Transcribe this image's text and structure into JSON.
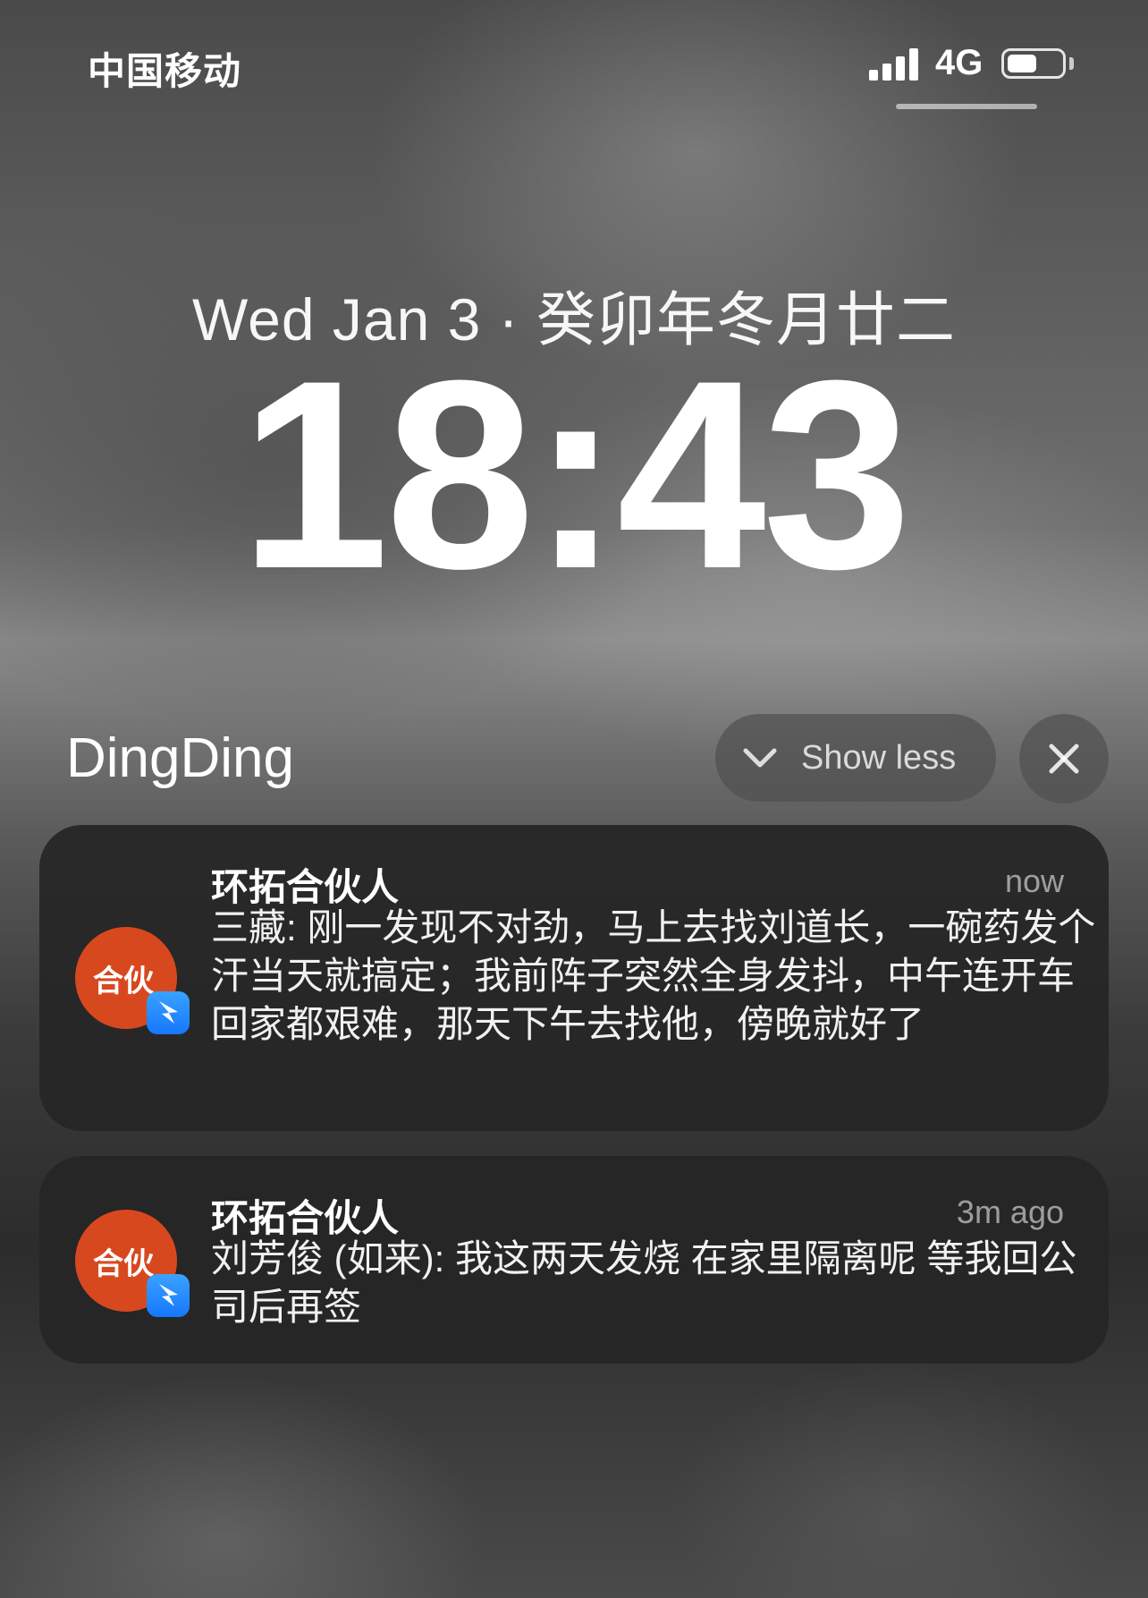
{
  "status_bar": {
    "carrier": "中国移动",
    "network": "4G",
    "signal_bars": 4,
    "battery_level": 0.55
  },
  "lock_screen": {
    "date": "Wed Jan 3 · 癸卯年冬月廿二",
    "time": "18:43"
  },
  "notification_group": {
    "app_name": "DingDing",
    "show_less_label": "Show less",
    "icons": [
      "chevron-down-icon",
      "close-icon"
    ]
  },
  "notifications": [
    {
      "app_icon_text": "合伙",
      "badge_icon": "dingtalk-icon",
      "title": "环拓合伙人",
      "time": "now",
      "message": "三藏: 刚一发现不对劲，马上去找刘道长，一碗药发个汗当天就搞定；我前阵子突然全身发抖，中午连开车回家都艰难，那天下午去找他，傍晚就好了"
    },
    {
      "app_icon_text": "合伙",
      "badge_icon": "dingtalk-icon",
      "title": "环拓合伙人",
      "time": "3m ago",
      "message": "刘芳俊 (如来): 我这两天发烧 在家里隔离呢 等我回公司后再签"
    }
  ],
  "colors": {
    "app_icon_bg": "#d8481f",
    "badge_bg": "#1677ff",
    "card_bg": "#262626"
  }
}
